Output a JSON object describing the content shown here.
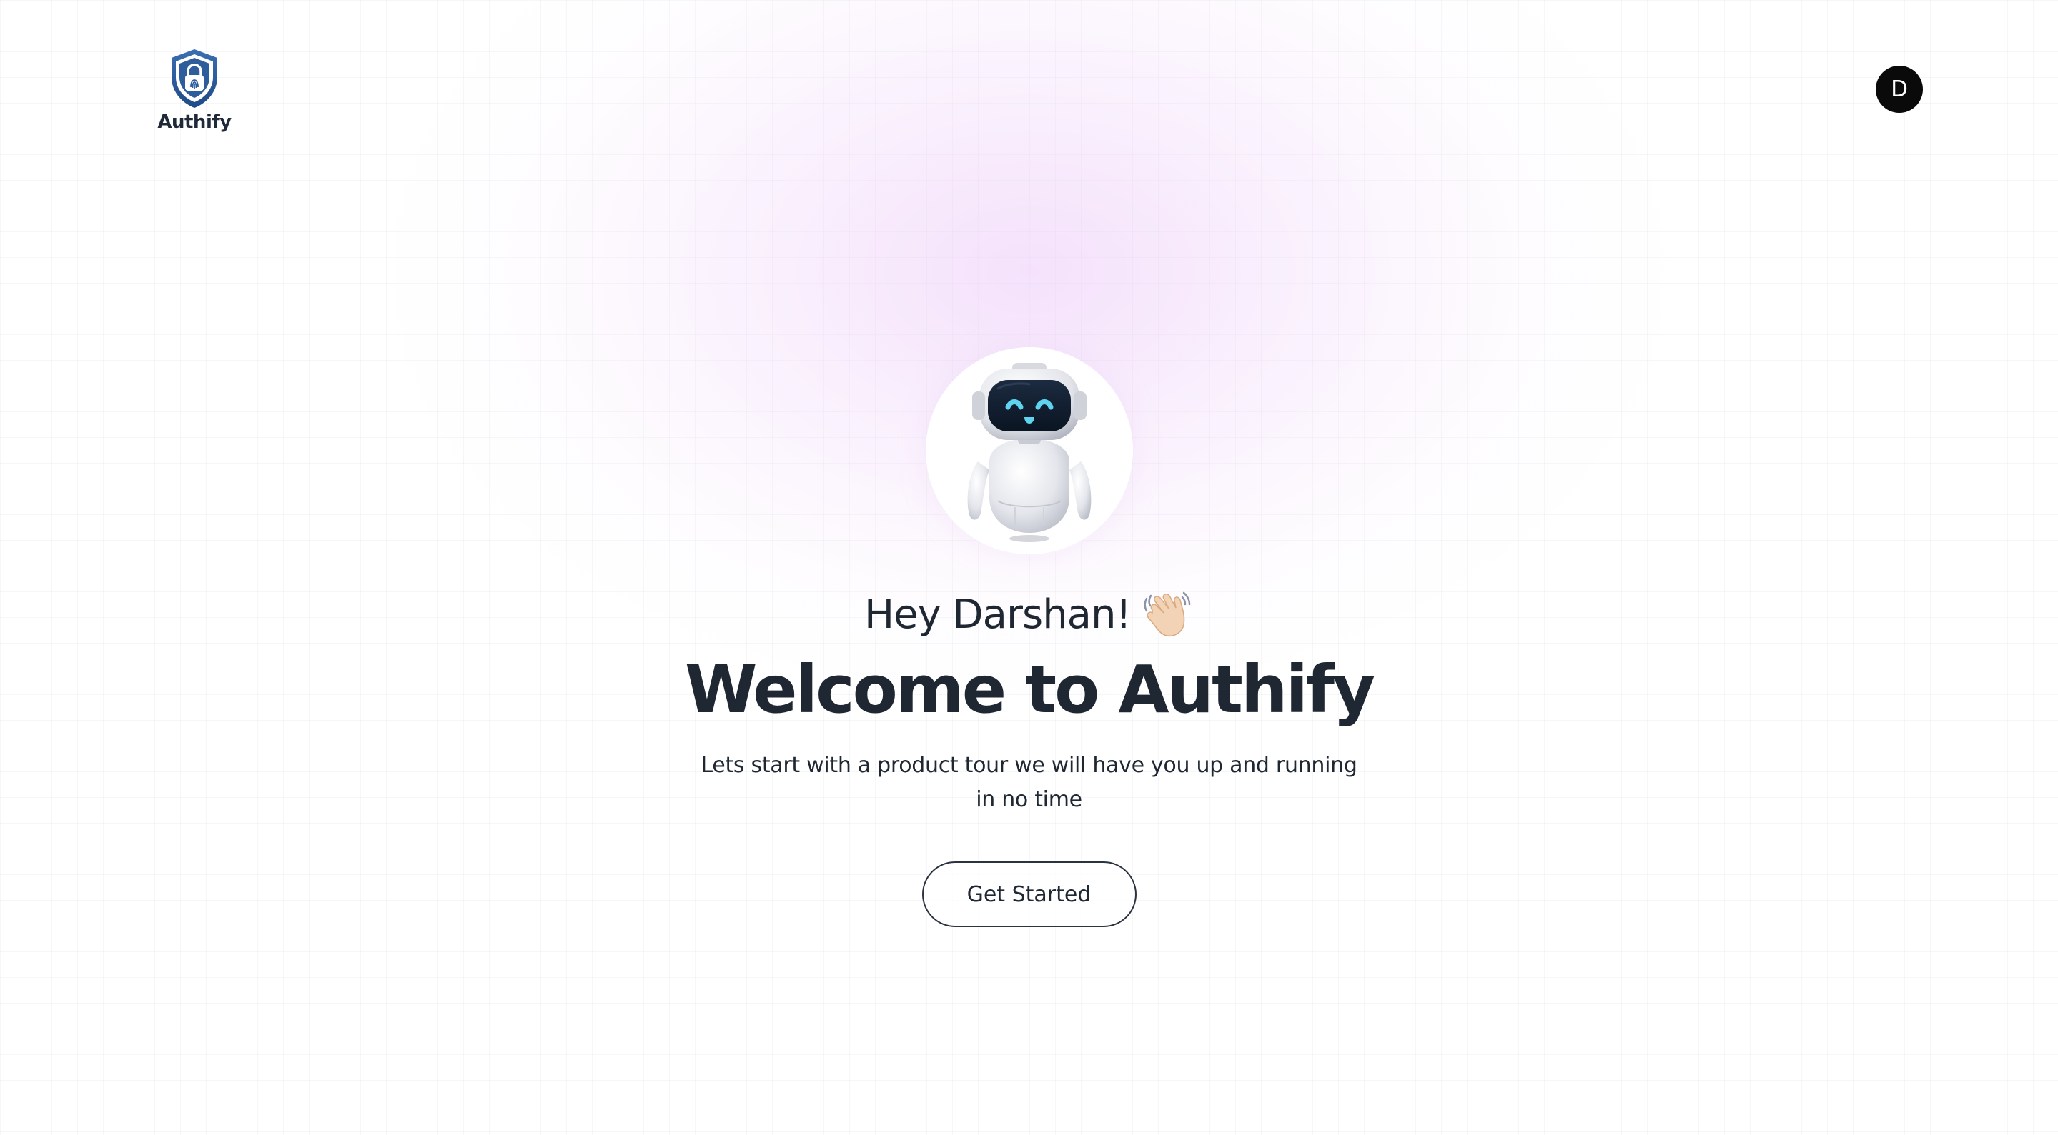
{
  "brand": {
    "name": "Authify",
    "logo_icon": "shield-lock-fingerprint-icon",
    "logo_color": "#2e5d9c"
  },
  "user": {
    "avatar_initial": "D",
    "avatar_bg": "#0a0a0a"
  },
  "hero": {
    "mascot_icon": "robot-mascot-icon",
    "greeting": "Hey Darshan!",
    "greeting_emoji": "waving-hand-icon",
    "headline": "Welcome to Authify",
    "subtitle": "Lets start with a product tour we will have you up and running in no time",
    "cta_label": "Get Started"
  },
  "colors": {
    "text": "#1f2733",
    "glow": "#ecc8f8",
    "robot_visor": "#0f1c2e",
    "robot_eyes": "#5fd4ee"
  }
}
